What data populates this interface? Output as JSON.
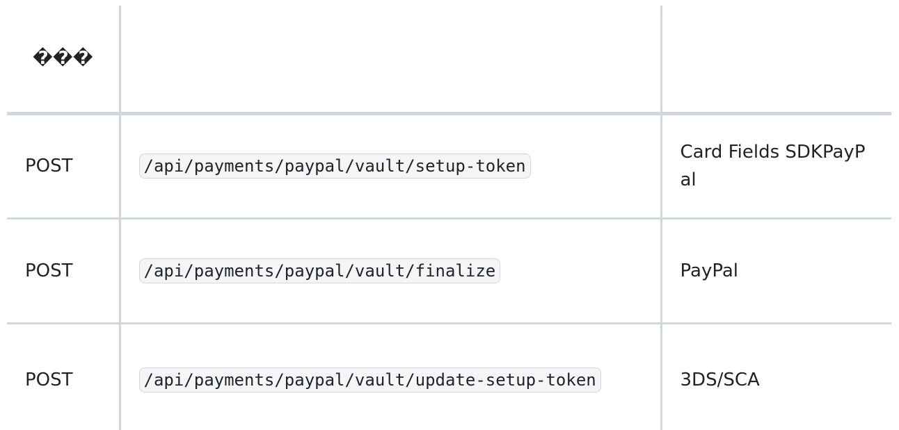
{
  "table": {
    "headers": {
      "method": "���\n",
      "path": "",
      "description": ""
    },
    "rows": [
      {
        "method": "POST",
        "path": "/api/payments/paypal/vault/setup-token",
        "description": "Card Fields SDKPayPal"
      },
      {
        "method": "POST",
        "path": "/api/payments/paypal/vault/finalize",
        "description": "PayPal"
      },
      {
        "method": "POST",
        "path": "/api/payments/paypal/vault/update-setup-token",
        "description": "3DS/SCA"
      }
    ]
  }
}
